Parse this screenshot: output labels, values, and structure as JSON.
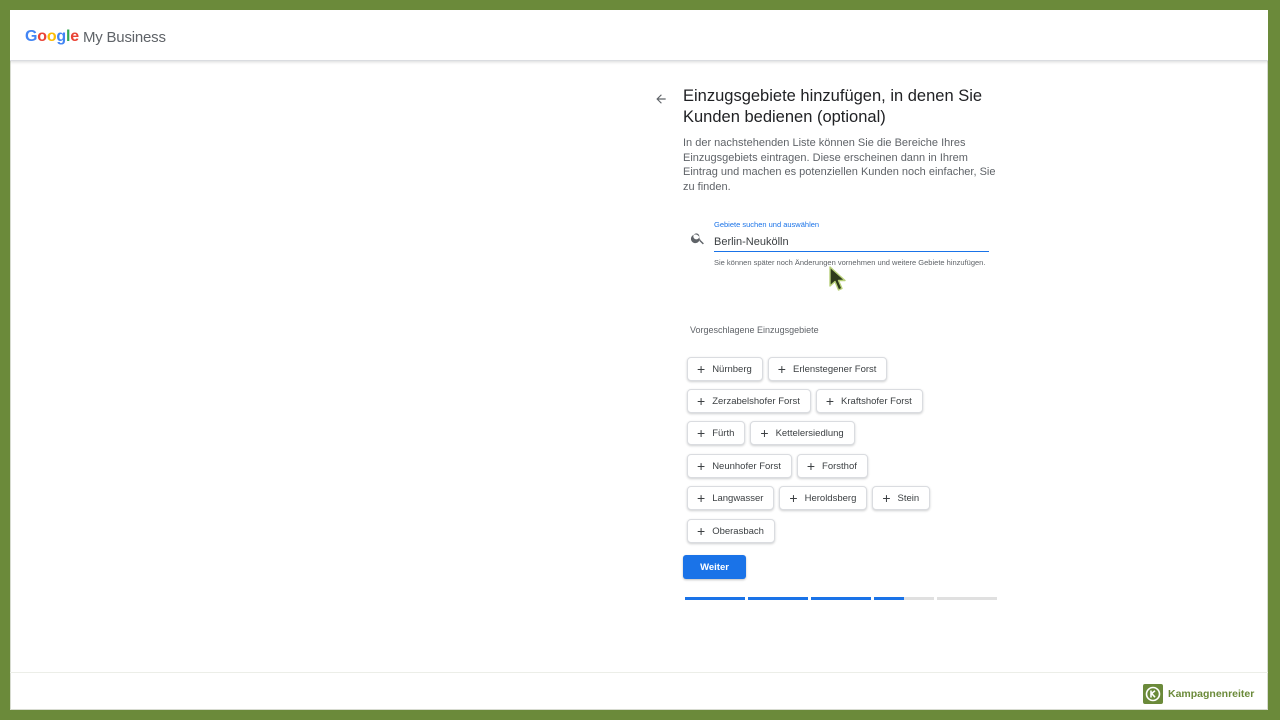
{
  "header": {
    "logo_letters": [
      {
        "char": "G",
        "color": "#4285F4"
      },
      {
        "char": "o",
        "color": "#EA4335"
      },
      {
        "char": "o",
        "color": "#FBBC05"
      },
      {
        "char": "g",
        "color": "#4285F4"
      },
      {
        "char": "l",
        "color": "#34A853"
      },
      {
        "char": "e",
        "color": "#EA4335"
      }
    ],
    "product": "My Business"
  },
  "page": {
    "back_icon": "arrow-left-icon",
    "title": "Einzugsgebiete hinzufügen, in denen Sie Kunden bedienen (optional)",
    "description": "In der nachstehenden Liste können Sie die Bereiche Ihres Einzugsgebiets eintragen. Diese erscheinen dann in Ihrem Eintrag und machen es potenziellen Kunden noch einfacher, Sie zu finden."
  },
  "search": {
    "icon": "search-icon",
    "label": "Gebiete suchen und auswählen",
    "value": "Berlin-Neukölln",
    "helper": "Sie können später noch Änderungen vornehmen und weitere Gebiete hinzufügen."
  },
  "suggestions": {
    "label": "Vorgeschlagene Einzugsgebiete",
    "rows": [
      [
        "Nürnberg",
        "Erlenstegener Forst"
      ],
      [
        "Zerzabelshofer Forst",
        "Kraftshofer Forst"
      ],
      [
        "Fürth",
        "Kettelersiedlung"
      ],
      [
        "Neunhofer Forst",
        "Forsthof"
      ],
      [
        "Langwasser",
        "Heroldsberg",
        "Stein"
      ],
      [
        "Oberasbach"
      ]
    ]
  },
  "actions": {
    "next": "Weiter"
  },
  "progress": {
    "segments": [
      1,
      1,
      1,
      0.5,
      0
    ]
  },
  "colors": {
    "accent": "#1a73e8",
    "frame": "#6b8a3a"
  },
  "brand": {
    "name": "Kampagnenreiter",
    "icon": "kampagnenreiter-k-icon"
  }
}
